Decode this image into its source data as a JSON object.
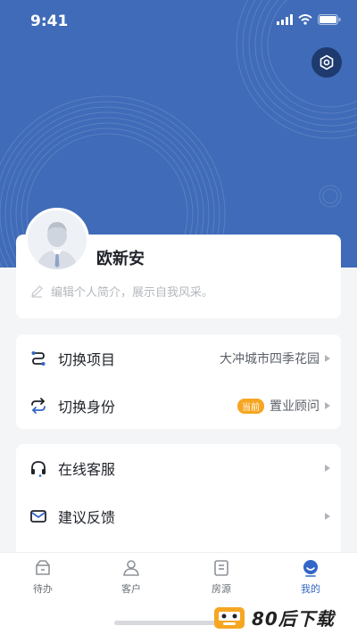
{
  "status_bar": {
    "time": "9:41"
  },
  "profile": {
    "name": "欧新安",
    "bio_placeholder": "编辑个人简介，展示自我风采。"
  },
  "menu": {
    "switch_project": {
      "label": "切换项目",
      "value": "大冲城市四季花园"
    },
    "switch_identity": {
      "label": "切换身份",
      "badge": "当前",
      "value": "置业顾问"
    },
    "online_service": {
      "label": "在线客服"
    },
    "feedback": {
      "label": "建议反馈"
    }
  },
  "tabbar": {
    "tabs": [
      {
        "label": "待办",
        "icon": "todo-icon"
      },
      {
        "label": "客户",
        "icon": "customer-icon"
      },
      {
        "label": "房源",
        "icon": "listing-icon"
      },
      {
        "label": "我的",
        "icon": "profile-icon",
        "active": true
      }
    ]
  },
  "watermark": {
    "text": "80后下载"
  },
  "colors": {
    "header": "#3f6bb8",
    "accent": "#3266c7",
    "badge": "#f6a623"
  }
}
